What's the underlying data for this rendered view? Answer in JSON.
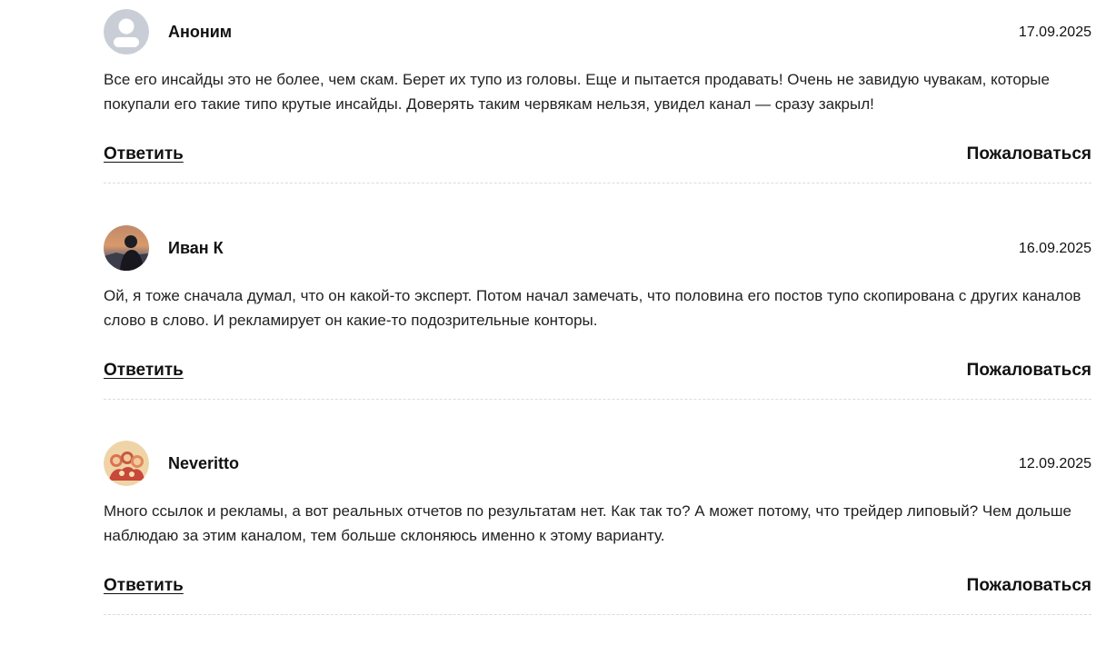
{
  "comments": [
    {
      "author": "Аноним",
      "date": "17.09.2025",
      "text": "Все его инсайды это не более, чем скам. Берет их тупо из головы. Еще и пытается продавать! Очень не завидую чувакам, которые покупали его такие типо крутые инсайды. Доверять таким червякам нельзя, увидел канал — сразу закрыл!",
      "reply_label": "Ответить",
      "report_label": "Пожаловаться",
      "avatar": "default-user-avatar"
    },
    {
      "author": "Иван К",
      "date": "16.09.2025",
      "text": "Ой, я тоже сначала думал, что он какой-то эксперт. Потом начал замечать, что половина его постов тупо скопирована с других каналов слово в слово. И рекламирует он какие-то подозрительные конторы.",
      "reply_label": "Ответить",
      "report_label": "Пожаловаться",
      "avatar": "photo-avatar"
    },
    {
      "author": "Neveritto",
      "date": "12.09.2025",
      "text": "Много ссылок и рекламы, а вот реальных отчетов по результатам нет. Как так то? А может потому, что трейдер липовый? Чем дольше наблюдаю за этим каналом, тем больше склоняюсь именно к этому варианту.",
      "reply_label": "Ответить",
      "report_label": "Пожаловаться",
      "avatar": "illustration-avatar"
    }
  ]
}
